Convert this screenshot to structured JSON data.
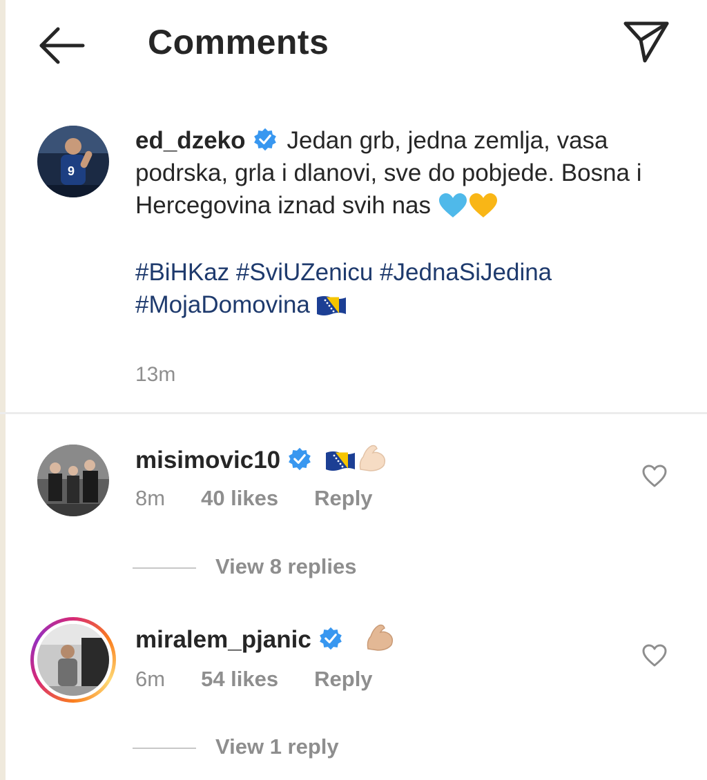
{
  "header": {
    "title": "Comments",
    "back_icon": "arrow-left-icon",
    "share_icon": "paper-plane-icon"
  },
  "caption": {
    "username": "ed_dzeko",
    "text": "Jedan grb, jedna zemlja, vasa podrska, grla i dlanovi, sve do pobjede. Bosna i Hercegovina iznad svih nas",
    "hashtags": [
      "#BiHKaz",
      "#SviUZenicu",
      "#JednaSiJedina",
      "#MojaDomovina"
    ],
    "time": "13m"
  },
  "comments": [
    {
      "username": "misimovic10",
      "time": "8m",
      "likes": "40 likes",
      "reply": "Reply",
      "view_replies": "View 8 replies"
    },
    {
      "username": "miralem_pjanic",
      "time": "6m",
      "likes": "54 likes",
      "reply": "Reply",
      "view_replies": "View 1 reply"
    }
  ],
  "colors": {
    "text": "#262626",
    "muted": "#8e8e8e",
    "hashtag": "#1e3a6d",
    "verified": "#3897f0",
    "heart_blue": "#4fb9ea",
    "heart_yellow": "#f9b616"
  }
}
